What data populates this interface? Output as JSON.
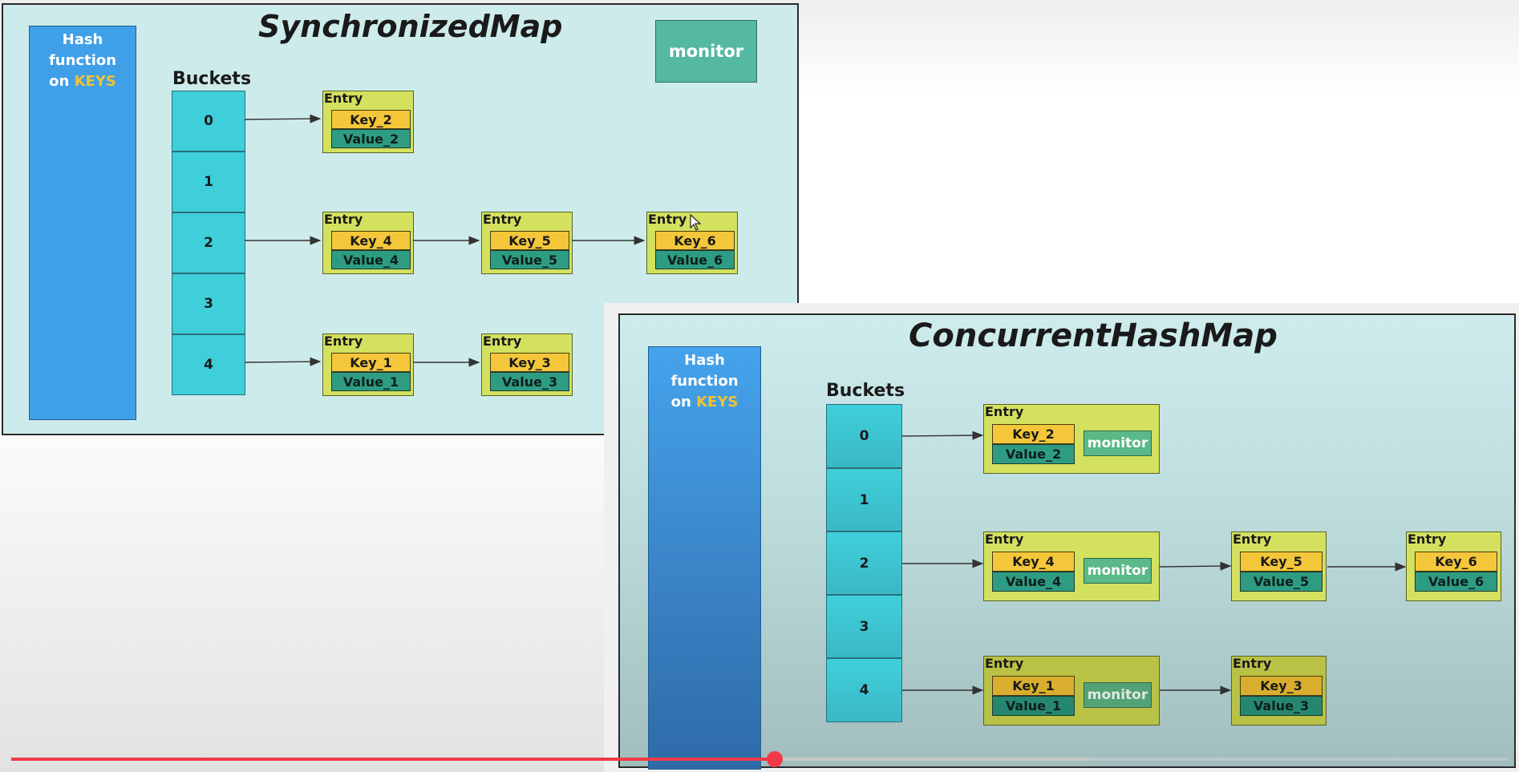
{
  "sync": {
    "title": "SynchronizedMap",
    "hash_line1": "Hash function",
    "hash_on": "on",
    "hash_keys": "KEYS",
    "buckets_label": "Buckets",
    "buckets": [
      "0",
      "1",
      "2",
      "3",
      "4"
    ],
    "monitor": "monitor",
    "entry_label": "Entry",
    "entries": [
      {
        "key": "Key_2",
        "value": "Value_2"
      },
      {
        "key": "Key_4",
        "value": "Value_4"
      },
      {
        "key": "Key_5",
        "value": "Value_5"
      },
      {
        "key": "Key_6",
        "value": "Value_6"
      },
      {
        "key": "Key_1",
        "value": "Value_1"
      },
      {
        "key": "Key_3",
        "value": "Value_3"
      }
    ]
  },
  "concurrent": {
    "title": "ConcurrentHashMap",
    "hash_line1": "Hash function",
    "hash_on": "on",
    "hash_keys": "KEYS",
    "buckets_label": "Buckets",
    "buckets": [
      "0",
      "1",
      "2",
      "3",
      "4"
    ],
    "monitor": "monitor",
    "entry_label": "Entry",
    "entries": [
      {
        "key": "Key_2",
        "value": "Value_2"
      },
      {
        "key": "Key_4",
        "value": "Value_4"
      },
      {
        "key": "Key_5",
        "value": "Value_5"
      },
      {
        "key": "Key_6",
        "value": "Value_6"
      },
      {
        "key": "Key_1",
        "value": "Value_1"
      },
      {
        "key": "Key_3",
        "value": "Value_3"
      }
    ]
  },
  "player": {
    "progress_fraction": 0.51,
    "buffered_fraction": 0.72,
    "played_color": "#f23a47",
    "buffered_color": "#c8c8c8"
  }
}
